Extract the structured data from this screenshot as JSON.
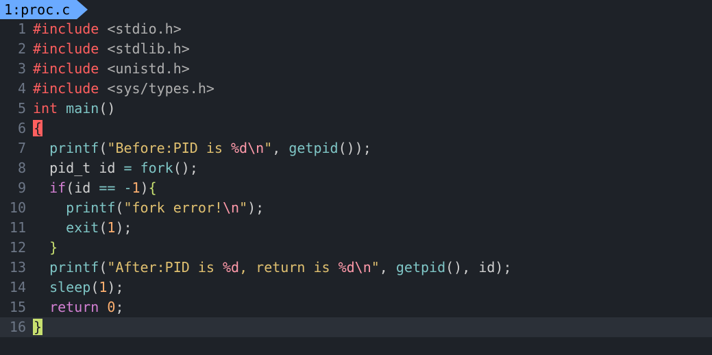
{
  "tab": {
    "index": "1",
    "filename": "proc.c"
  },
  "lines": {
    "n1": "1",
    "n2": "2",
    "n3": "3",
    "n4": "4",
    "n5": "5",
    "n6": "6",
    "n7": "7",
    "n8": "8",
    "n9": "9",
    "n10": "10",
    "n11": "11",
    "n12": "12",
    "n13": "13",
    "n14": "14",
    "n15": "15",
    "n16": "16"
  },
  "code": {
    "inc1_kw": "#include ",
    "inc1_hd": "<stdio.h>",
    "inc2_kw": "#include ",
    "inc2_hd": "<stdlib.h>",
    "inc3_kw": "#include ",
    "inc3_hd": "<unistd.h>",
    "inc4_kw": "#include ",
    "inc4_hd": "<sys/types.h>",
    "l5_int": "int ",
    "l5_main": "main",
    "l5_par": "()",
    "l6_brace": "{",
    "l7_indent": "  ",
    "l7_printf": "printf",
    "l7_open": "(",
    "l7_q1": "\"",
    "l7_s1": "Before:PID is ",
    "l7_fmt": "%d\\n",
    "l7_q2": "\"",
    "l7_comma": ", ",
    "l7_getpid": "getpid",
    "l7_par": "()",
    "l7_close": ");",
    "l8_indent": "  ",
    "l8_pid": "pid_t id ",
    "l8_eq": "= ",
    "l8_fork": "fork",
    "l8_par": "();",
    "l9_indent": "  ",
    "l9_if": "if",
    "l9_open": "(",
    "l9_id": "id ",
    "l9_eq": "== ",
    "l9_neg": "-",
    "l9_one": "1",
    "l9_close": ")",
    "l9_brace": "{",
    "l10_indent": "    ",
    "l10_printf": "printf",
    "l10_open": "(",
    "l10_q1": "\"",
    "l10_s": "fork error!",
    "l10_fmt": "\\n",
    "l10_q2": "\"",
    "l10_close": ");",
    "l11_indent": "    ",
    "l11_exit": "exit",
    "l11_open": "(",
    "l11_one": "1",
    "l11_close": ");",
    "l12_indent": "  ",
    "l12_brace": "}",
    "l13_indent": "  ",
    "l13_printf": "printf",
    "l13_open": "(",
    "l13_q1": "\"",
    "l13_s1": "After:PID is ",
    "l13_fmt1": "%d",
    "l13_s2": ", return is ",
    "l13_fmt2": "%d\\n",
    "l13_q2": "\"",
    "l13_c1": ", ",
    "l13_getpid": "getpid",
    "l13_par": "()",
    "l13_c2": ", ",
    "l13_id": "id",
    "l13_close": ");",
    "l14_indent": "  ",
    "l14_sleep": "sleep",
    "l14_open": "(",
    "l14_one": "1",
    "l14_close": ");",
    "l15_indent": "  ",
    "l15_ret": "return ",
    "l15_zero": "0",
    "l15_semi": ";",
    "l16_brace": "}"
  }
}
